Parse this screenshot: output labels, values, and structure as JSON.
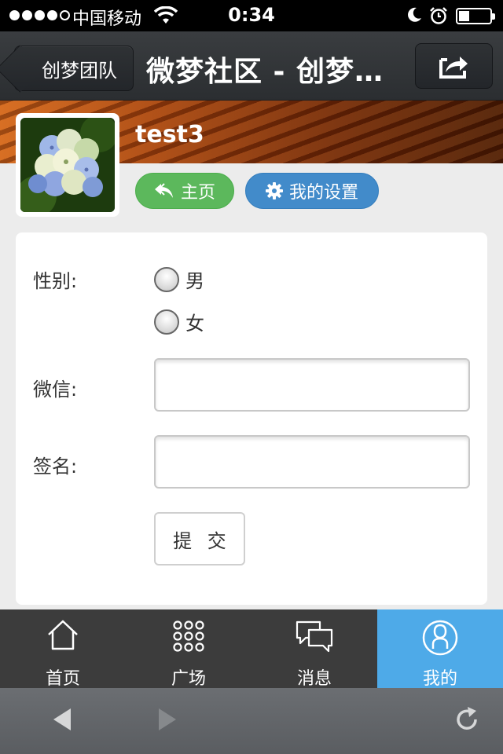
{
  "status_bar": {
    "carrier": "中国移动",
    "time": "0:34",
    "signal_bars_filled": 4,
    "signal_bars_total": 5,
    "icons": [
      "signal-icon",
      "wifi-icon",
      "moon-icon",
      "alarm-icon",
      "battery-icon"
    ]
  },
  "navbar": {
    "back_label": "创梦团队",
    "title": "微梦社区 - 创梦…",
    "share_icon": "share-icon"
  },
  "profile": {
    "username": "test3",
    "home_button": "主页",
    "settings_button": "我的设置",
    "home_color": "#5cb85c",
    "settings_color": "#428bca"
  },
  "form": {
    "gender_label": "性别:",
    "gender_options": [
      "男",
      "女"
    ],
    "wechat_label": "微信:",
    "wechat_value": "",
    "signature_label": "签名:",
    "signature_value": "",
    "submit_label": "提 交"
  },
  "tabbar": {
    "active_color": "#4eaae8",
    "tabs": [
      {
        "label": "首页",
        "icon": "home-icon",
        "active": false
      },
      {
        "label": "广场",
        "icon": "grid-icon",
        "active": false
      },
      {
        "label": "消息",
        "icon": "chat-icon",
        "active": false
      },
      {
        "label": "我的",
        "icon": "user-icon",
        "active": true
      }
    ]
  },
  "browser_toolbar": {
    "icons": [
      "back-arrow-icon",
      "forward-arrow-icon",
      "reload-icon"
    ]
  }
}
